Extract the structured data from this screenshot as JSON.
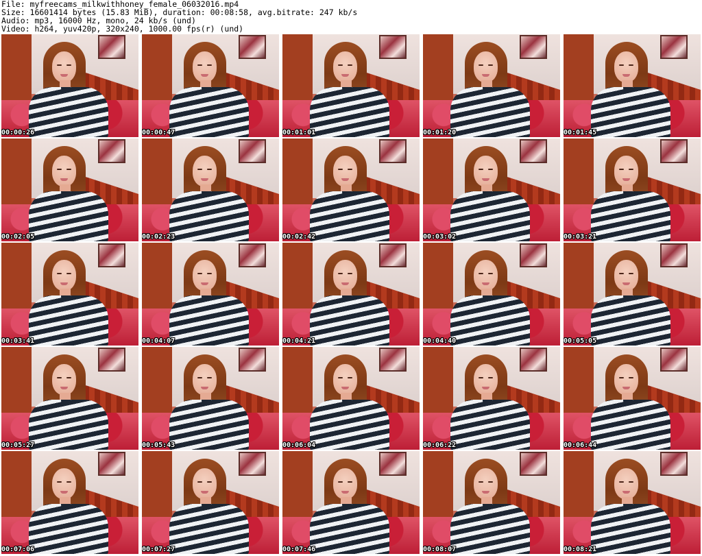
{
  "header": {
    "file": "File: myfreecams_milkwithhoney_female_06032016.mp4",
    "size": "Size: 16601414 bytes (15.83 MiB), duration: 00:08:58, avg.bitrate: 247 kb/s",
    "audio": "Audio: mp3, 16000 Hz, mono, 24 kb/s (und)",
    "video": "Video: h264, yuv420p, 320x240, 1000.00 fps(r) (und)"
  },
  "frames": [
    {
      "timestamp": "00:00:26"
    },
    {
      "timestamp": "00:00:47"
    },
    {
      "timestamp": "00:01:01"
    },
    {
      "timestamp": "00:01:20"
    },
    {
      "timestamp": "00:01:45"
    },
    {
      "timestamp": "00:02:05"
    },
    {
      "timestamp": "00:02:23"
    },
    {
      "timestamp": "00:02:42"
    },
    {
      "timestamp": "00:03:02"
    },
    {
      "timestamp": "00:03:21"
    },
    {
      "timestamp": "00:03:41"
    },
    {
      "timestamp": "00:04:07"
    },
    {
      "timestamp": "00:04:21"
    },
    {
      "timestamp": "00:04:40"
    },
    {
      "timestamp": "00:05:05"
    },
    {
      "timestamp": "00:05:27"
    },
    {
      "timestamp": "00:05:43"
    },
    {
      "timestamp": "00:06:04"
    },
    {
      "timestamp": "00:06:22"
    },
    {
      "timestamp": "00:06:44"
    },
    {
      "timestamp": "00:07:06"
    },
    {
      "timestamp": "00:07:27"
    },
    {
      "timestamp": "00:07:46"
    },
    {
      "timestamp": "00:08:07"
    },
    {
      "timestamp": "00:08:21"
    }
  ]
}
